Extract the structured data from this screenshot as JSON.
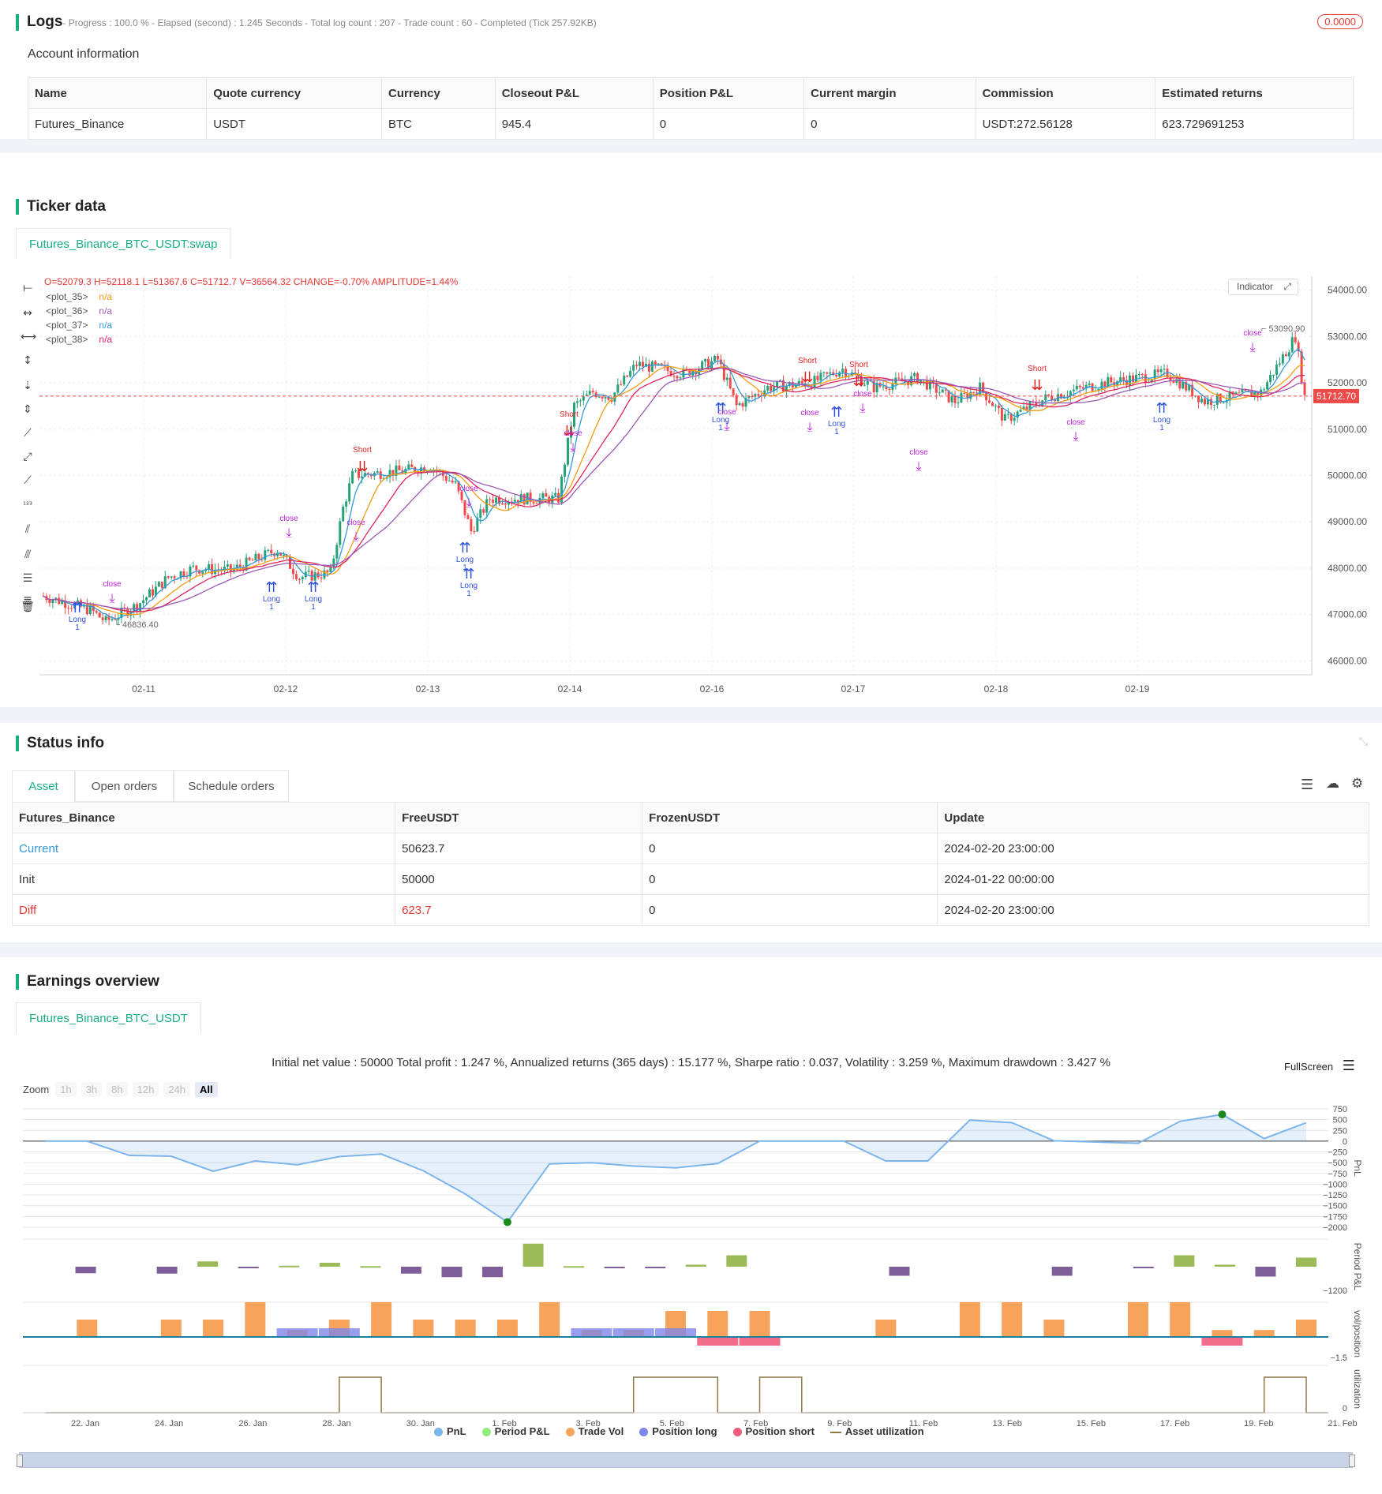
{
  "logs": {
    "title": "Logs",
    "summary": "- Progress : 100.0 % - Elapsed (second) : 1.245  Seconds - Total log count : 207 - Trade count : 60 - Completed (Tick 257.92KB)",
    "badge": "0.0000",
    "account_title": "Account information",
    "columns": [
      "Name",
      "Quote currency",
      "Currency",
      "Closeout P&L",
      "Position P&L",
      "Current margin",
      "Commission",
      "Estimated returns"
    ],
    "row": [
      "Futures_Binance",
      "USDT",
      "BTC",
      "945.4",
      "0",
      "0",
      "USDT:272.56128",
      "623.729691253"
    ]
  },
  "ticker": {
    "title": "Ticker data",
    "tab": "Futures_Binance_BTC_USDT:swap",
    "ohlc_line": "O=52079.3 H=52118.1 L=51367.6 C=51712.7 V=36564.32 CHANGE=-0.70% AMPLITUDE=1.44%",
    "legend": [
      {
        "name": "<plot_35>",
        "value": "n/a",
        "color": "#f39c12"
      },
      {
        "name": "<plot_36>",
        "value": "n/a",
        "color": "#9b59b6"
      },
      {
        "name": "<plot_37>",
        "value": "n/a",
        "color": "#3498db"
      },
      {
        "name": "<plot_38>",
        "value": "n/a",
        "color": "#e0245e"
      }
    ],
    "indicator_btn": "Indicator",
    "price_labels": [
      "54000.00",
      "53000.00",
      "52000.00",
      "51000.00",
      "50000.00",
      "49000.00",
      "48000.00",
      "47000.00",
      "46000.00"
    ],
    "date_labels": [
      "02-11",
      "02-12",
      "02-13",
      "02-14",
      "02-16",
      "02-17",
      "02-18",
      "02-19"
    ],
    "last_price": "51712.70",
    "high_label": "53090.90",
    "low_label": "46836.40",
    "signal_words": {
      "long": "Long",
      "long_lc": "long",
      "short": "Short",
      "short_lc": "short",
      "close": "close",
      "one": "1"
    }
  },
  "status": {
    "title": "Status info",
    "tabs": [
      "Asset",
      "Open orders",
      "Schedule orders"
    ],
    "columns": [
      "Futures_Binance",
      "FreeUSDT",
      "FrozenUSDT",
      "Update"
    ],
    "rows": [
      [
        "Current",
        "50623.7",
        "0",
        "2024-02-20 23:00:00"
      ],
      [
        "Init",
        "50000",
        "0",
        "2024-01-22 00:00:00"
      ],
      [
        "Diff",
        "623.7",
        "0",
        "2024-02-20 23:00:00"
      ]
    ]
  },
  "earnings": {
    "title": "Earnings overview",
    "tab": "Futures_Binance_BTC_USDT",
    "summary": "Initial net value : 50000 Total profit : 1.247 %, Annualized returns (365 days) : 15.177 %, Sharpe ratio : 0.037, Volatility : 3.259 %, Maximum drawdown : 3.427 %",
    "fullscreen": "FullScreen",
    "zoom_label": "Zoom",
    "zoom_options": [
      "1h",
      "3h",
      "8h",
      "12h",
      "24h",
      "All"
    ],
    "pnl_axis": [
      "750",
      "500",
      "250",
      "0",
      "−250",
      "−500",
      "−750",
      "−1000",
      "−1250",
      "−1500",
      "−1750",
      "−2000"
    ],
    "period_axis": "−1200",
    "vol_axis": "−1.5",
    "util_axis": "0",
    "axis_titles": [
      "PnL",
      "Period P&L",
      "vol/position",
      "utilization"
    ],
    "x_labels": [
      "22. Jan",
      "24. Jan",
      "26. Jan",
      "28. Jan",
      "30. Jan",
      "1. Feb",
      "3. Feb",
      "5. Feb",
      "7. Feb",
      "9. Feb",
      "11. Feb",
      "13. Feb",
      "15. Feb",
      "17. Feb",
      "19. Feb",
      "21. Feb"
    ],
    "legend": [
      {
        "name": "PnL",
        "color": "#7cb5ec"
      },
      {
        "name": "Period P&L",
        "color": "#90ed7d"
      },
      {
        "name": "Trade Vol",
        "color": "#f7a35c"
      },
      {
        "name": "Position long",
        "color": "#8085e9"
      },
      {
        "name": "Position short",
        "color": "#f15c80"
      },
      {
        "name": "Asset utilization",
        "color": "#8d7a48"
      }
    ]
  },
  "chart_data": [
    {
      "type": "line",
      "title": "",
      "series": [
        {
          "name": "PnL",
          "values": [
            0,
            0,
            -330,
            -350,
            -700,
            -460,
            -550,
            -360,
            -300,
            -690,
            -1230,
            -1880,
            -530,
            -500,
            -580,
            -620,
            -520,
            0,
            0,
            0,
            -460,
            -460,
            490,
            430,
            10,
            -20,
            -50,
            460,
            620,
            60,
            430
          ]
        }
      ],
      "ylim": [
        -2000,
        750
      ]
    },
    {
      "type": "bar",
      "series": [
        {
          "name": "Period P&L",
          "values": [
            0,
            -330,
            0,
            -350,
            270,
            -50,
            50,
            200,
            30,
            -350,
            -530,
            -530,
            1170,
            30,
            -80,
            -80,
            100,
            580,
            0,
            0,
            0,
            -460,
            0,
            0,
            0,
            -460,
            0,
            -20,
            580,
            100,
            -500,
            460
          ]
        }
      ]
    },
    {
      "type": "bar",
      "series": [
        {
          "name": "Trade Vol",
          "values": [
            0,
            1,
            0,
            1,
            1,
            2,
            0.4,
            1,
            2,
            1,
            1,
            1,
            2,
            0.4,
            0.4,
            1.5,
            1.5,
            1.5,
            0,
            0,
            1,
            0,
            2,
            2,
            1,
            0,
            2,
            2,
            0.4,
            0.4,
            1
          ]
        },
        {
          "name": "Position long",
          "values": [
            0,
            0,
            0,
            0,
            0,
            0,
            0.5,
            0.5,
            0,
            0,
            0,
            0,
            0,
            0.5,
            0.5,
            0.5,
            0,
            0,
            0,
            0,
            0,
            0,
            0,
            0,
            0,
            0,
            0,
            0,
            0,
            0,
            0
          ]
        },
        {
          "name": "Position short",
          "values": [
            0,
            0,
            0,
            0,
            0,
            0,
            0,
            0,
            0,
            0,
            0,
            0,
            0,
            0,
            0,
            0,
            -0.5,
            -0.5,
            0,
            0,
            0,
            0,
            0,
            0,
            0,
            0,
            0,
            0,
            -0.5,
            0,
            0
          ]
        }
      ]
    },
    {
      "type": "line",
      "series": [
        {
          "name": "Asset utilization",
          "values": [
            0,
            0,
            0,
            0,
            0,
            0,
            0,
            1,
            0,
            0,
            0,
            0,
            0,
            0,
            1,
            1,
            0,
            1,
            0,
            0,
            0,
            0,
            0,
            0,
            0,
            0,
            0,
            0,
            0,
            1,
            0
          ]
        }
      ]
    }
  ]
}
